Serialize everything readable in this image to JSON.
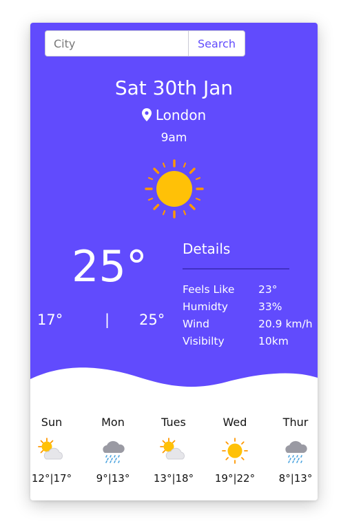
{
  "search": {
    "placeholder": "City",
    "button_label": "Search"
  },
  "current": {
    "date": "Sat 30th Jan",
    "location": "London",
    "time": "9am",
    "icon": "sun-icon",
    "temperature": "25°",
    "low": "17°",
    "separator": "|",
    "high": "25°"
  },
  "details": {
    "title": "Details",
    "rows": [
      {
        "label": "Feels Like",
        "value": "23°"
      },
      {
        "label": "Humidty",
        "value": "33%"
      },
      {
        "label": "Wind",
        "value": "20.9 km/h"
      },
      {
        "label": "Visibilty",
        "value": "10km"
      }
    ]
  },
  "forecast": [
    {
      "day": "Sun",
      "icon": "partly-cloudy-icon",
      "temps": "12°|17°"
    },
    {
      "day": "Mon",
      "icon": "rain-cloud-icon",
      "temps": "9°|13°"
    },
    {
      "day": "Tues",
      "icon": "partly-cloudy-icon",
      "temps": "13°|18°"
    },
    {
      "day": "Wed",
      "icon": "sun-icon",
      "temps": "19°|22°"
    },
    {
      "day": "Thur",
      "icon": "rain-cloud-icon",
      "temps": "8°|13°"
    }
  ],
  "colors": {
    "accent": "#614bfd",
    "sun": "#ffc107",
    "sun_rays": "#ff9800",
    "cloud": "#e6e6ea",
    "rain": "#4aa3df"
  }
}
